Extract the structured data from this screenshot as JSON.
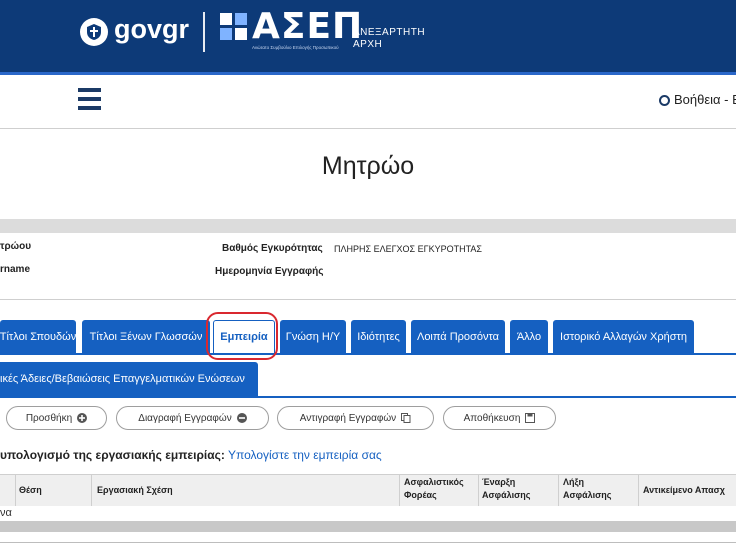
{
  "header": {
    "gov_brand_a": "gov",
    "gov_brand_b": "gr",
    "asep_word": "ΑΣΕΠ",
    "asep_sub": "Ανώτατο Συμβούλιο Επιλογής Προσωπικού",
    "authority_line1": "ΑΝΕΞΑΡΤΗΤΗ",
    "authority_line2": "ΑΡΧΗ",
    "colors": {
      "bar": "#0d3a78",
      "accent": "#2a67c9"
    }
  },
  "navbar": {
    "menu_icon": "hamburger-icon",
    "help_label": "Βοήθεια - Ε"
  },
  "page": {
    "title": "Μητρώο"
  },
  "info": {
    "left_label1": "τρώου",
    "left_label2": "rname",
    "validity_label": "Βαθμός Εγκυρότητας",
    "validity_value": "ΠΛΗΡΗΣ ΕΛΕΓΧΟΣ ΕΓΚΥΡΟΤΗΤΑΣ",
    "reg_date_label": "Ημερομηνία Εγγραφής"
  },
  "tabs": [
    {
      "label": "Τίτλοι Σπουδών"
    },
    {
      "label": "Τίτλοι Ξένων Γλωσσών"
    },
    {
      "label": "Εμπειρία",
      "active": true
    },
    {
      "label": "Γνώση Η/Υ"
    },
    {
      "label": "Ιδιότητες"
    },
    {
      "label": "Λοιπά Προσόντα"
    },
    {
      "label": "Άλλο"
    },
    {
      "label": "Ιστορικό Αλλαγών Χρήστη"
    }
  ],
  "tab_row2": {
    "label": "ικές Άδειες/Βεβαιώσεις Επαγγελματικών Ενώσεων"
  },
  "toolbar": {
    "add": "Προσθήκη",
    "delete": "Διαγραφή Εγγραφών",
    "copy": "Αντιγραφή Εγγραφών",
    "save": "Αποθήκευση"
  },
  "calc": {
    "text": "υπολογισμό της εργασιακής εμπειρίας:",
    "link": "Υπολογίστε την εμπειρία σας"
  },
  "table": {
    "columns": [
      "Θέση",
      "Εργασιακή Σχέση",
      "Ασφαλιστικός Φορέας",
      "Έναρξη Ασφάλισης",
      "Λήξη Ασφάλισης",
      "Αντικείμενο Απασχ"
    ],
    "first_cell": "να"
  }
}
